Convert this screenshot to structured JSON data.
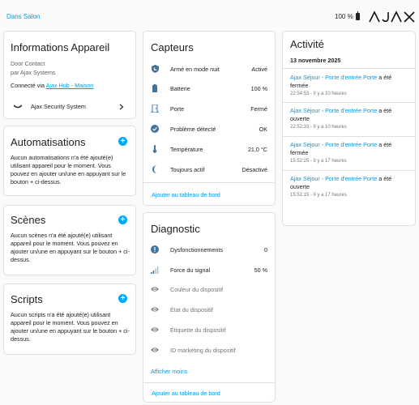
{
  "header": {
    "breadcrumb": "Dans Salon",
    "battery": "100 %",
    "logo": "AJAX"
  },
  "device_info": {
    "title": "Informations Appareil",
    "model": "Door Contact",
    "manufacturer": "par Ajax Systems",
    "connected_prefix": "Connecté via ",
    "connected_link": "Ajax Hub - Maison",
    "integration": "Ajax Security System"
  },
  "automations": {
    "title": "Automatisations",
    "text": "Aucun automatisations n'a été ajouté(e) utilisant appareil pour le moment. Vous pouvez en ajouter un/une en appuyant sur le bouton + ci-dessus."
  },
  "scenes": {
    "title": "Scènes",
    "text": "Aucun scènes n'a été ajouté(e) utilisant appareil pour le moment. Vous pouvez en ajouter un/une en appuyant sur le bouton + ci-dessus."
  },
  "scripts": {
    "title": "Scripts",
    "text": "Aucun scripts n'a été ajouté(e) utilisant appareil pour le moment. Vous pouvez en ajouter un/une en appuyant sur le bouton + ci-dessus."
  },
  "sensors": {
    "title": "Capteurs",
    "rows": [
      {
        "icon": "shield-moon-icon",
        "label": "Armé en mode nuit",
        "value": "Activé"
      },
      {
        "icon": "battery-icon",
        "label": "Batterie",
        "value": "100 %"
      },
      {
        "icon": "door-icon",
        "label": "Porte",
        "value": "Fermé"
      },
      {
        "icon": "check-circle-icon",
        "label": "Problème détecté",
        "value": "OK"
      },
      {
        "icon": "thermometer-icon",
        "label": "Température",
        "value": "21,0 °C"
      },
      {
        "icon": "moon-icon",
        "label": "Toujours actif",
        "value": "Désactivé"
      }
    ],
    "add_link": "Ajouter au tableau de bord"
  },
  "diagnostic": {
    "title": "Diagnostic",
    "rows": [
      {
        "icon": "alert-circle-icon",
        "label": "Dysfonctionnements",
        "value": "0"
      },
      {
        "icon": "signal-icon",
        "label": "Force du signal",
        "value": "50 %"
      },
      {
        "icon": "eye-icon",
        "label": "Couleur du dispositif",
        "value": ""
      },
      {
        "icon": "eye-icon",
        "label": "État du dispositif",
        "value": ""
      },
      {
        "icon": "eye-icon",
        "label": "Étiquette du dispositif",
        "value": ""
      },
      {
        "icon": "eye-icon",
        "label": "ID marketing du dispositif",
        "value": ""
      }
    ],
    "show_less": "Afficher moins",
    "add_link": "Ajouter au tableau de bord"
  },
  "activity": {
    "title": "Activité",
    "date": "13 novembre 2025",
    "items": [
      {
        "entity": "Ajax Séjour - Porte d'entrée Porte",
        "text": "a été fermée",
        "time": "22:54:53 - Il y a 10 heures"
      },
      {
        "entity": "Ajax Séjour - Porte d'entrée Porte",
        "text": "a été ouverte",
        "time": "22:52:33 - Il y a 10 heures"
      },
      {
        "entity": "Ajax Séjour - Porte d'entrée Porte",
        "text": "a été fermée",
        "time": "15:52:25 - Il y a 17 heures"
      },
      {
        "entity": "Ajax Séjour - Porte d'entrée Porte",
        "text": "a été ouverte",
        "time": "15:51:15 - Il y a 17 heures"
      }
    ]
  },
  "colors": {
    "accent": "#03a9f4",
    "link": "#039be5",
    "icon": "#44739e"
  }
}
